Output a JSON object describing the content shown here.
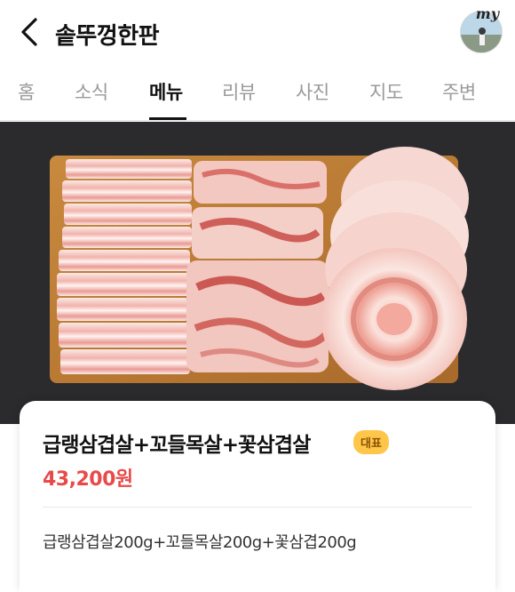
{
  "header": {
    "store_name": "솥뚜껑한판",
    "my_label": "my"
  },
  "tabs": [
    {
      "label": "홈"
    },
    {
      "label": "소식"
    },
    {
      "label": "메뉴"
    },
    {
      "label": "리뷰"
    },
    {
      "label": "사진"
    },
    {
      "label": "지도"
    },
    {
      "label": "주변"
    }
  ],
  "active_tab": "메뉴",
  "menu_item": {
    "name": "급랭삼겹살+꼬들목살+꽃삼겹살",
    "badge": "대표",
    "price": "43,200원",
    "description": "급랭삼겹살200g+꼬들목살200g+꽃삼겹200g"
  },
  "colors": {
    "price": "#e84a4a",
    "badge_bg": "#ffc64a",
    "hero_bg": "#2b2b2d"
  },
  "icons": {
    "back": "chevron-left-icon",
    "profile": "profile-avatar"
  }
}
